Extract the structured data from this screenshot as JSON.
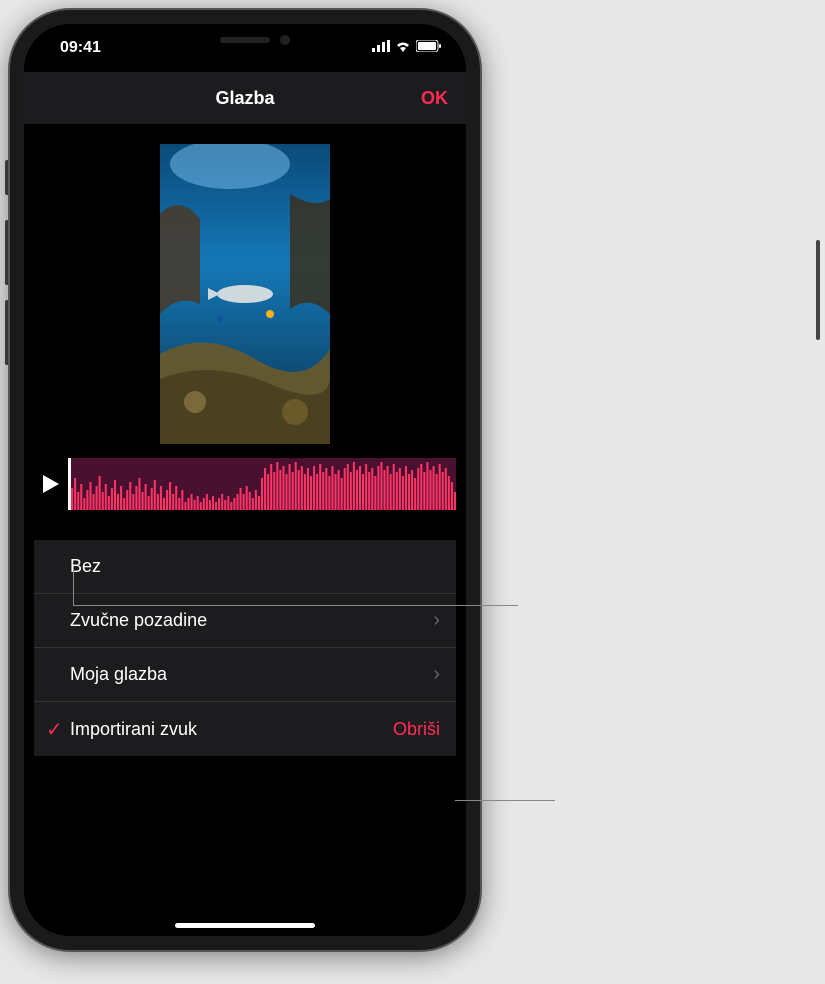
{
  "status": {
    "time": "09:41"
  },
  "nav": {
    "title": "Glazba",
    "ok": "OK"
  },
  "options": {
    "none": "Bez",
    "soundtracks": "Zvučne pozadine",
    "my_music": "Moja glazba",
    "imported": "Importirani zvuk",
    "delete": "Obriši"
  }
}
